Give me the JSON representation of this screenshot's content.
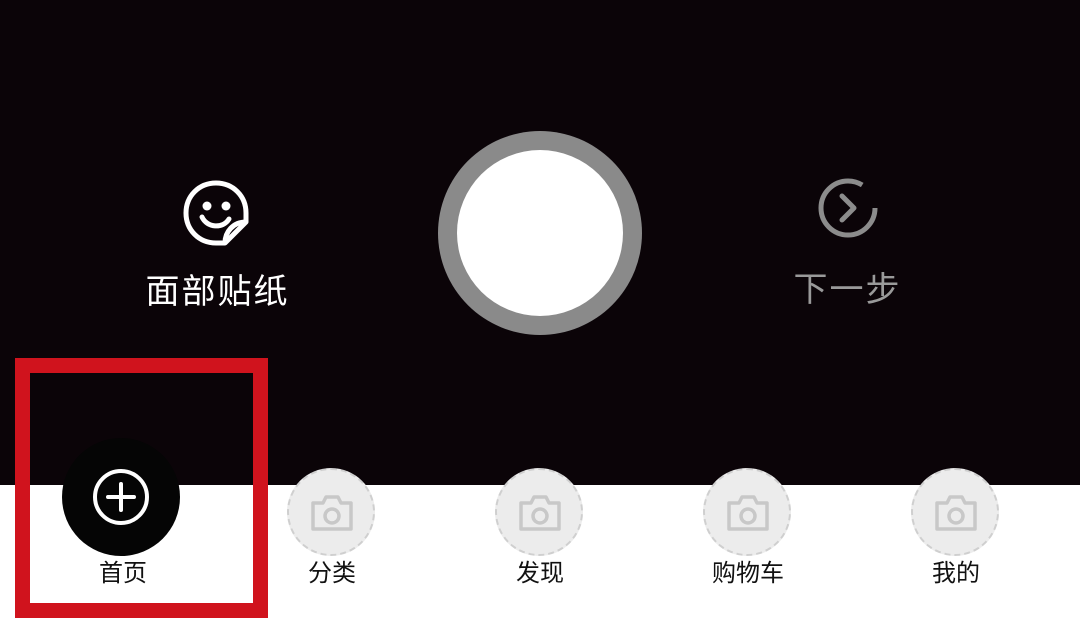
{
  "camera": {
    "face_sticker": {
      "label": "面部贴纸",
      "icon": "face-sticker-icon"
    },
    "shutter": {
      "icon": "shutter-button"
    },
    "next_step": {
      "label": "下一步",
      "icon": "chevron-right-circle-icon"
    }
  },
  "tabs": [
    {
      "label": "首页",
      "icon": "plus-circle-icon",
      "selected": true
    },
    {
      "label": "分类",
      "icon": "camera-icon",
      "selected": false
    },
    {
      "label": "发现",
      "icon": "camera-icon",
      "selected": false
    },
    {
      "label": "购物车",
      "icon": "camera-icon",
      "selected": false
    },
    {
      "label": "我的",
      "icon": "camera-icon",
      "selected": false
    }
  ],
  "colors": {
    "camera_background": "#0b0408",
    "shutter_ring": "#8a8a8a",
    "highlight": "#d0131d",
    "inactive_label": "#9a9a9a",
    "tab_label": "#111111"
  }
}
